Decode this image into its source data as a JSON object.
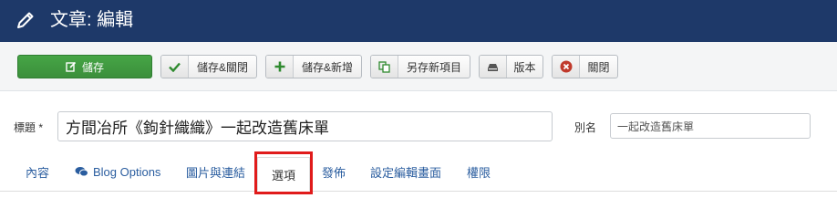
{
  "header": {
    "title": "文章: 編輯",
    "icon": "pencil-icon"
  },
  "toolbar": {
    "save": "儲存",
    "save_close": "儲存&關閉",
    "save_new": "儲存&新增",
    "save_copy": "另存新項目",
    "versions": "版本",
    "close": "關閉"
  },
  "form": {
    "title_label": "標題 *",
    "title_value": "方間冶所《鉤針織織》一起改造舊床單",
    "alias_label": "別名",
    "alias_value": "一起改造舊床單"
  },
  "tabs": [
    {
      "label": "內容"
    },
    {
      "label": "Blog Options"
    },
    {
      "label": "圖片與連結"
    },
    {
      "label": "選項"
    },
    {
      "label": "發佈"
    },
    {
      "label": "設定編輯畫面"
    },
    {
      "label": "權限"
    }
  ],
  "colors": {
    "header_bg": "#1e3969",
    "save_green": "#46a546",
    "link_blue": "#2a5d9f",
    "highlight_red": "#e01b1b"
  }
}
